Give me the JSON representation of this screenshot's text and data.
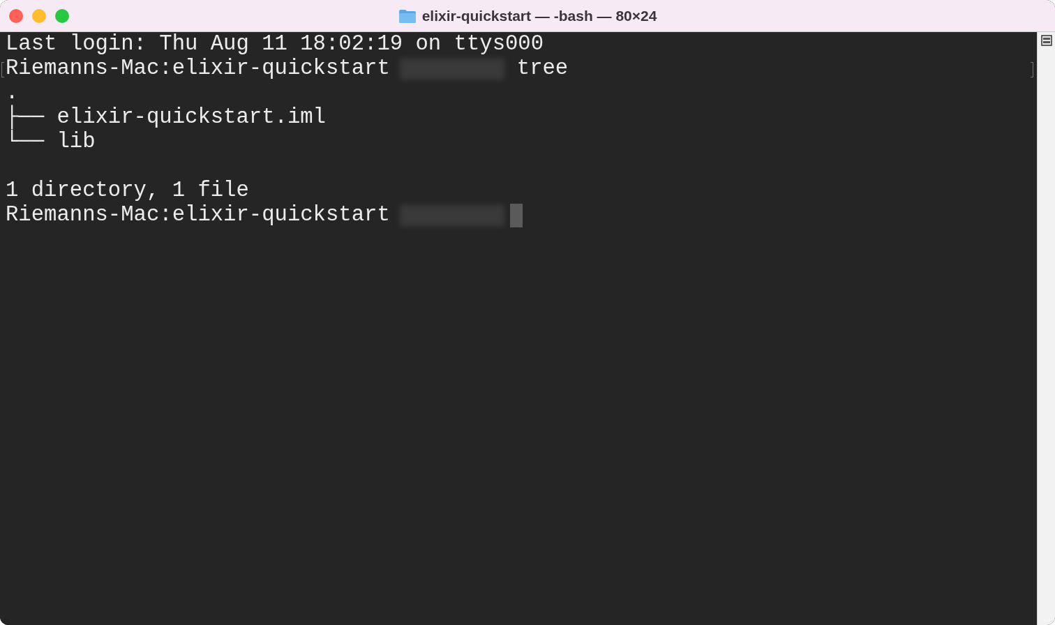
{
  "window": {
    "title": "elixir-quickstart — -bash — 80×24"
  },
  "lines": [
    {
      "kind": "output",
      "text": "Last login: Thu Aug 11 18:02:19 on ttys000",
      "marked": false
    },
    {
      "kind": "prompt",
      "prompt": "Riemanns-Mac:elixir-quickstart",
      "command": "tree",
      "cursor": false,
      "marked": true
    },
    {
      "kind": "output",
      "text": ".",
      "marked": false
    },
    {
      "kind": "output",
      "text": "├── elixir-quickstart.iml",
      "marked": false
    },
    {
      "kind": "output",
      "text": "└── lib",
      "marked": false
    },
    {
      "kind": "blank",
      "marked": false
    },
    {
      "kind": "output",
      "text": "1 directory, 1 file",
      "marked": false
    },
    {
      "kind": "prompt",
      "prompt": "Riemanns-Mac:elixir-quickstart",
      "cursor": true,
      "marked": false
    }
  ]
}
